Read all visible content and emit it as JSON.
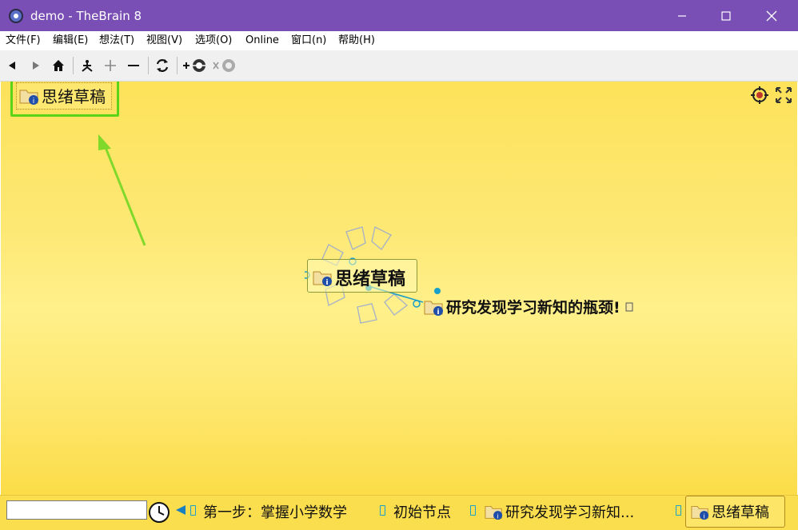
{
  "window": {
    "title": "demo - TheBrain 8",
    "controls": {
      "minimize": "—",
      "maximize": "☐",
      "close": "✕"
    }
  },
  "menu": {
    "items": [
      "文件(F)",
      "编辑(E)",
      "想法(T)",
      "视图(V)",
      "选项(O)",
      "Online",
      "窗口(n)",
      "帮助(H)"
    ]
  },
  "toolbar": {
    "buttons": [
      "back-arrow-icon",
      "forward-arrow-icon",
      "home-icon",
      "focus-icon",
      "zoom-in-icon",
      "zoom-out-icon",
      "refresh-icon",
      "link-thought-icon",
      "unlink-thought-icon"
    ]
  },
  "canvas": {
    "pinned_thought": "思绪草稿",
    "central_thought": "思绪草稿",
    "child_thought": "研究发现学习新知的瓶颈!"
  },
  "bottom": {
    "search_value": "",
    "history": [
      "第一步：掌握小学数学",
      "初始节点",
      "研究发现学习新知...",
      "思绪草稿"
    ]
  },
  "colors": {
    "titlebar": "#7a4fb5",
    "canvas": "#fde66a",
    "highlight": "#5bd316",
    "link": "#1aa0c8"
  }
}
